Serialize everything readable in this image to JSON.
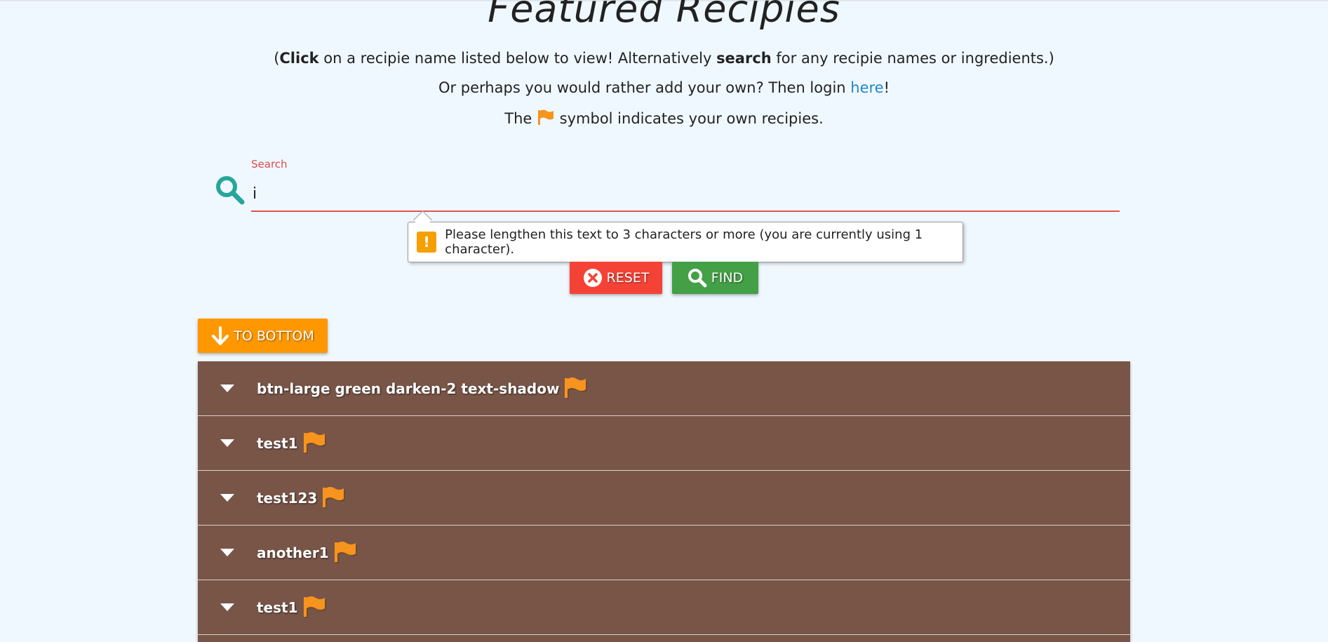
{
  "page": {
    "title": "Featured Recipies",
    "intro_open": "(",
    "intro_click": "Click",
    "intro_mid": " on a recipie name listed below to view! Alternatively ",
    "intro_search": "search",
    "intro_end": " for any recipie names or ingredients.)",
    "login_prefix": "Or perhaps you would rather add your own? Then login ",
    "login_link": "here",
    "login_suffix": "!",
    "flag_prefix": "The ",
    "flag_suffix": " symbol indicates your own recipies."
  },
  "search": {
    "label": "Search",
    "value": "i",
    "validation_message": "Please lengthen this text to 3 characters or more (you are currently using 1 character).",
    "warning_glyph": "!"
  },
  "buttons": {
    "reset": "RESET",
    "find": "FIND",
    "to_bottom": "TO BOTTOM"
  },
  "recipes": [
    {
      "name": "btn-large green darken-2 text-shadow"
    },
    {
      "name": "test1"
    },
    {
      "name": "test123"
    },
    {
      "name": "another1"
    },
    {
      "name": "test1"
    }
  ],
  "colors": {
    "background": "#f0f8ff",
    "accent_teal": "#26a69a",
    "reset": "#f44336",
    "find": "#43a047",
    "to_bottom": "#ff9800",
    "list": "#795548",
    "flag": "#f7941d",
    "link": "#1e88c9",
    "invalid": "#e35252"
  },
  "icons": {
    "search": "search-icon",
    "flag": "flag-icon",
    "reset": "close-circle-icon",
    "find": "search-icon",
    "to_bottom": "arrow-down-icon",
    "expand": "caret-down-icon",
    "warning": "warning-icon"
  }
}
